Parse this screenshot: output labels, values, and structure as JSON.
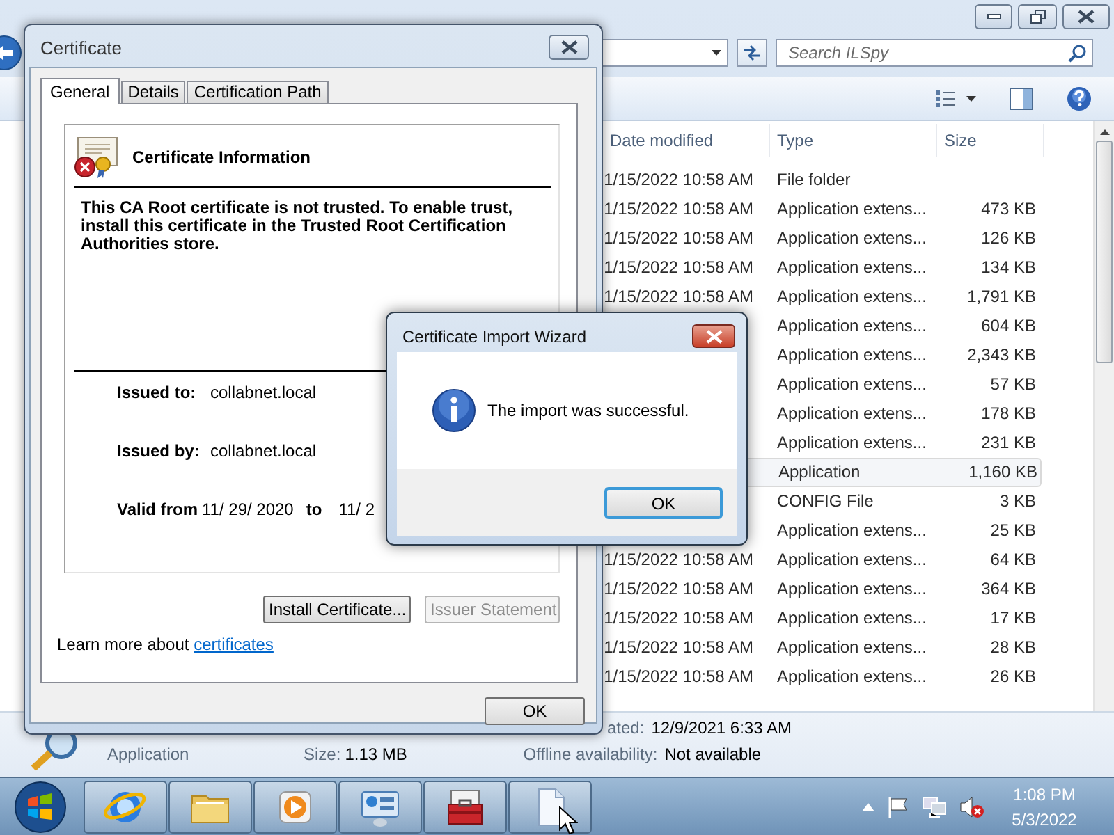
{
  "explorer": {
    "search": {
      "placeholder": "Search ILSpy"
    },
    "columns": [
      "Date modified",
      "Type",
      "Size"
    ],
    "rows": [
      {
        "date": "1/15/2022 10:58 AM",
        "type": "File folder",
        "selected": false
      },
      {
        "date": "1/15/2022 10:58 AM",
        "type": "Application extens...",
        "size": "473 KB",
        "selected": false
      },
      {
        "date": "1/15/2022 10:58 AM",
        "type": "Application extens...",
        "size": "126 KB",
        "selected": false
      },
      {
        "date": "1/15/2022 10:58 AM",
        "type": "Application extens...",
        "size": "134 KB",
        "selected": false
      },
      {
        "date": "1/15/2022 10:58 AM",
        "type": "Application extens...",
        "size": "1,791 KB",
        "selected": false
      },
      {
        "type": "Application extens...",
        "size": "604 KB",
        "selected": false
      },
      {
        "type": "Application extens...",
        "size": "2,343 KB",
        "selected": false
      },
      {
        "type": "Application extens...",
        "size": "57 KB",
        "selected": false
      },
      {
        "type": "Application extens...",
        "size": "178 KB",
        "selected": false
      },
      {
        "type": "Application extens...",
        "size": "231 KB",
        "selected": false
      },
      {
        "type": "Application",
        "size": "1,160 KB",
        "selected": true
      },
      {
        "type": "CONFIG File",
        "size": "3 KB",
        "selected": false
      },
      {
        "type": "Application extens...",
        "size": "25 KB",
        "selected": false
      },
      {
        "date": "1/15/2022 10:58 AM",
        "type": "Application extens...",
        "size": "64 KB",
        "selected": false
      },
      {
        "date": "1/15/2022 10:58 AM",
        "type": "Application extens...",
        "size": "364 KB",
        "selected": false
      },
      {
        "date": "1/15/2022 10:58 AM",
        "type": "Application extens...",
        "size": "17 KB",
        "selected": false
      },
      {
        "date": "1/15/2022 10:58 AM",
        "type": "Application extens...",
        "size": "28 KB",
        "selected": false
      },
      {
        "date": "1/15/2022 10:58 AM",
        "type": "Application extens...",
        "size": "26 KB",
        "selected": false
      }
    ],
    "details": {
      "created_label": "ated:",
      "created": "12/9/2021 6:33 AM",
      "type": "Application",
      "size_label": "Size:",
      "size": "1.13 MB",
      "offline_label": "Offline availability:",
      "offline": "Not available"
    }
  },
  "certificate_dialog": {
    "title": "Certificate",
    "tabs": [
      {
        "label": "General",
        "selected": true
      },
      {
        "label": "Details",
        "selected": false
      },
      {
        "label": "Certification Path",
        "selected": false
      }
    ],
    "info_title": "Certificate Information",
    "message": "This CA Root certificate is not trusted. To enable trust, install this certificate in the Trusted Root Certification Authorities store.",
    "issued_to_label": "Issued to:",
    "issued_to": "collabnet.local",
    "issued_by_label": "Issued by:",
    "issued_by": "collabnet.local",
    "valid_from_label": "Valid from",
    "valid_from": "11/ 29/ 2020",
    "to_label": "to",
    "valid_to": "11/ 2",
    "buttons": [
      {
        "label": "Install Certificate...",
        "disabled": false
      },
      {
        "label": "Issuer Statement",
        "disabled": true
      }
    ],
    "learn_more": "Learn more about",
    "link": "certificates",
    "ok": "OK"
  },
  "wizard": {
    "title": "Certificate Import Wizard",
    "message": "The import was successful.",
    "ok": "OK"
  },
  "taskbar": {
    "time": "1:08 PM",
    "date": "5/3/2022"
  }
}
